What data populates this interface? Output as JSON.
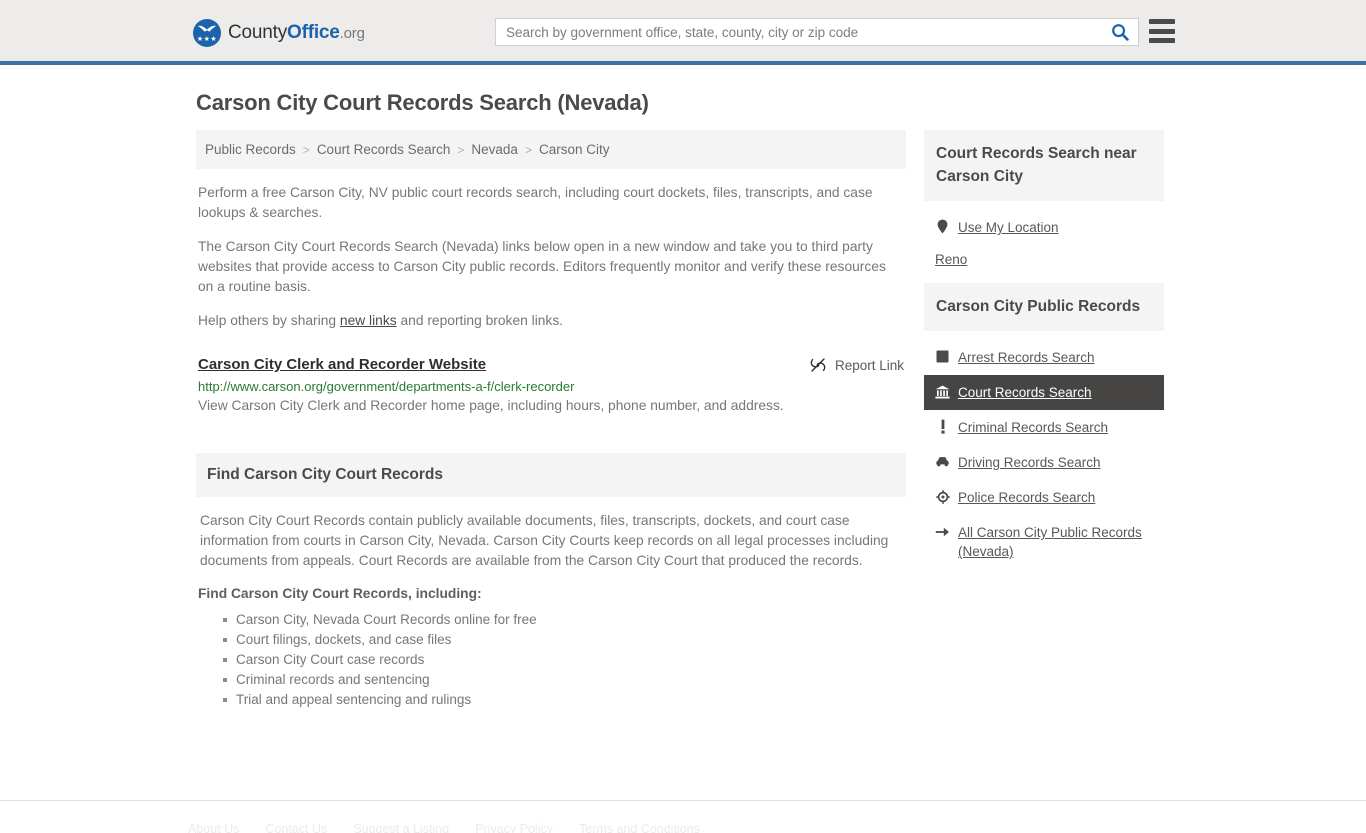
{
  "header": {
    "logo": {
      "name_part1": "County",
      "name_part2": "Office",
      "name_suffix": ".org",
      "stars": "★★★"
    },
    "search": {
      "placeholder": "Search by government office, state, county, city or zip code",
      "value": "",
      "search_icon": "search-icon"
    },
    "menu_icon": "hamburger-menu-icon",
    "accent_color": "#3b72a4",
    "background_color": "#eeeceb"
  },
  "page": {
    "title": "Carson City Court Records Search (Nevada)"
  },
  "breadcrumb": {
    "separator": ">",
    "items": [
      {
        "label": "Public Records",
        "current": false
      },
      {
        "label": "Court Records Search",
        "current": false
      },
      {
        "label": "Nevada",
        "current": false
      },
      {
        "label": "Carson City",
        "current": true
      }
    ]
  },
  "main": {
    "intro_paragraph": "Perform a free Carson City, NV public court records search, including court dockets, files, transcripts, and case lookups & searches.",
    "detail_paragraph": "The Carson City Court Records Search (Nevada) links below open in a new window and take you to third party websites that provide access to Carson City public records. Editors frequently monitor and verify these resources on a routine basis.",
    "help_prefix": "Help others by sharing ",
    "help_link": "new links",
    "help_suffix": " and reporting broken links.",
    "listing": {
      "title": "Carson City Clerk and Recorder Website",
      "url": "http://www.carson.org/government/departments-a-f/clerk-recorder",
      "description": "View Carson City Clerk and Recorder home page, including hours, phone number, and address.",
      "report_label": "Report Link",
      "report_icon": "broken-link-icon"
    },
    "section": {
      "heading": "Find Carson City Court Records",
      "body": "Carson City Court Records contain publicly available documents, files, transcripts, dockets, and court case information from courts in Carson City, Nevada. Carson City Courts keep records on all legal processes including documents from appeals. Court Records are available from the Carson City Court that produced the records.",
      "list_lead": "Find Carson City Court Records, including:",
      "bullets": [
        "Carson City, Nevada Court Records online for free",
        "Court filings, dockets, and case files",
        "Carson City Court case records",
        "Criminal records and sentencing",
        "Trial and appeal sentencing and rulings"
      ]
    }
  },
  "sidebar": {
    "nearby": {
      "heading": "Court Records Search near Carson City",
      "use_my_location": {
        "label": "Use My Location",
        "icon": "map-pin-icon"
      },
      "places": [
        {
          "label": "Reno"
        }
      ]
    },
    "public_records": {
      "heading": "Carson City Public Records",
      "active_background": "#464544",
      "items": [
        {
          "label": "Arrest Records Search",
          "icon": "fingerprint-square-icon",
          "active": false
        },
        {
          "label": "Court Records Search",
          "icon": "courthouse-icon",
          "active": true
        },
        {
          "label": "Criminal Records Search",
          "icon": "exclamation-icon",
          "active": false
        },
        {
          "label": "Driving Records Search",
          "icon": "car-icon",
          "active": false
        },
        {
          "label": "Police Records Search",
          "icon": "police-badge-icon",
          "active": false
        },
        {
          "label": "All Carson City Public Records (Nevada)",
          "icon": "arrow-right-icon",
          "active": false
        }
      ]
    }
  },
  "footer": {
    "links": [
      {
        "label": "About Us"
      },
      {
        "label": "Contact Us"
      },
      {
        "label": "Suggest a Listing"
      },
      {
        "label": "Privacy Policy"
      },
      {
        "label": "Terms and Conditions"
      }
    ]
  }
}
